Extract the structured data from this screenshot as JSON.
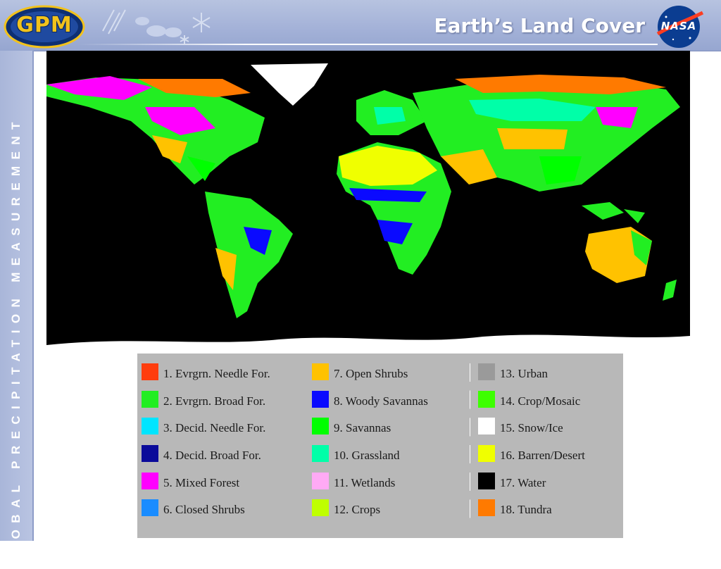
{
  "header": {
    "title": "Earth’s Land Cover",
    "gpm_logo_text": "GPM",
    "nasa_logo_text": "NASA"
  },
  "sidebar": {
    "text": "GLOBAL PRECIPITATION MEASUREMENT"
  },
  "map": {
    "background_color": "#000000",
    "land_color_samples": [
      "#ff8c00",
      "#ff00ff",
      "#00ff00",
      "#ffff00",
      "#0000ff",
      "#00ffa0",
      "#ffffff",
      "#ffc800"
    ]
  },
  "legend": {
    "items": [
      {
        "label": "1. Evrgrn. Needle For.",
        "color": "#ff3d0d"
      },
      {
        "label": "2. Evrgrn. Broad For.",
        "color": "#22ee22"
      },
      {
        "label": "3. Decid. Needle For.",
        "color": "#00e5ff"
      },
      {
        "label": "4. Decid. Broad For.",
        "color": "#0b0b9a"
      },
      {
        "label": "5. Mixed Forest",
        "color": "#ff00ff"
      },
      {
        "label": "6. Closed Shrubs",
        "color": "#1a8cff"
      },
      {
        "label": "7. Open Shrubs",
        "color": "#ffc200"
      },
      {
        "label": "8. Woody Savannas",
        "color": "#0a0aff"
      },
      {
        "label": "9. Savannas",
        "color": "#00ff00"
      },
      {
        "label": "10. Grassland",
        "color": "#00ffa8"
      },
      {
        "label": "11. Wetlands",
        "color": "#ffaaf5"
      },
      {
        "label": "12. Crops",
        "color": "#bfff00"
      },
      {
        "label": "13. Urban",
        "color": "#9a9a9a"
      },
      {
        "label": "14. Crop/Mosaic",
        "color": "#3dff00"
      },
      {
        "label": "15. Snow/Ice",
        "color": "#ffffff"
      },
      {
        "label": "16. Barren/Desert",
        "color": "#f0ff00"
      },
      {
        "label": "17. Water",
        "color": "#000000"
      },
      {
        "label": "18. Tundra",
        "color": "#ff7a00"
      }
    ]
  }
}
